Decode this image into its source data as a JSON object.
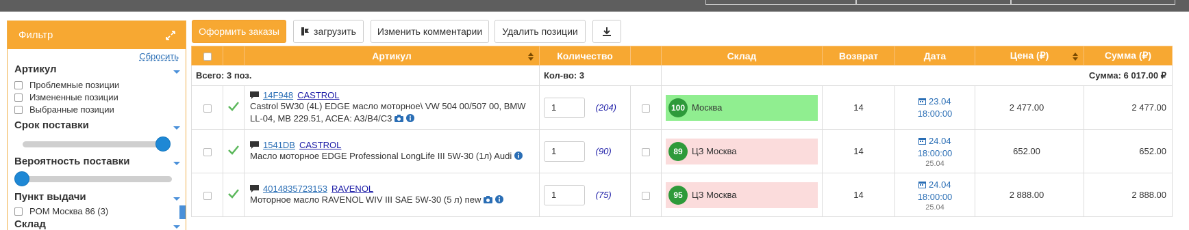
{
  "filter": {
    "title": "Фильтр",
    "reset": "Сбросить",
    "sections": {
      "article": "Артикул",
      "delivery_time": "Срок поставки",
      "delivery_probability": "Вероятность поставки",
      "pickup_point": "Пункт выдачи",
      "warehouse": "Склад"
    },
    "article_options": [
      "Проблемные позиции",
      "Измененные позиции",
      "Выбранные позиции"
    ],
    "pickup_options": [
      "POM Москва 86 (3)"
    ],
    "delivery_time_level": 1.0,
    "delivery_probability_level": 0.0
  },
  "toolbar": {
    "place_orders": "Оформить заказы",
    "upload": "загрузить",
    "change_comments": "Изменить комментарии",
    "delete_positions": "Удалить позиции"
  },
  "table": {
    "headers": {
      "article": "Артикул",
      "quantity": "Количество",
      "warehouse": "Склад",
      "return": "Возврат",
      "date": "Дата",
      "price": "Цена (₽)",
      "sum": "Сумма (₽)"
    },
    "totals": {
      "total_positions": "Всего: 3 поз.",
      "total_qty": "Кол-во: 3",
      "total_sum": "Сумма: 6 017.00 ₽"
    },
    "rows": [
      {
        "code": "14F948",
        "brand": "CASTROL",
        "description": "Castrol 5W30 (4L) EDGE масло моторное\\ VW 504 00/507 00, BMW LL-04, MB 229.51, ACEA: A3/B4/C3",
        "qty": "1",
        "available": "(204)",
        "badge": "100",
        "warehouse": "Москва",
        "warehouse_state": "green",
        "return": "14",
        "date": "23.04",
        "time": "18:00:00",
        "date_extra": "",
        "price": "2 477.00",
        "sum": "2 477.00"
      },
      {
        "code": "1541DB",
        "brand": "CASTROL",
        "description": "Масло моторное EDGE Professional LongLife III 5W-30 (1л) Audi",
        "qty": "1",
        "available": "(90)",
        "badge": "89",
        "warehouse": "ЦЗ Москва",
        "warehouse_state": "pink",
        "return": "14",
        "date": "24.04",
        "time": "18:00:00",
        "date_extra": "25.04",
        "price": "652.00",
        "sum": "652.00"
      },
      {
        "code": "4014835723153",
        "brand": "RAVENOL",
        "description": "Моторное масло RAVENOL WIV III SAE 5W-30 (5 л) new",
        "qty": "1",
        "available": "(75)",
        "badge": "95",
        "warehouse": "ЦЗ Москва",
        "warehouse_state": "pink",
        "return": "14",
        "date": "24.04",
        "time": "18:00:00",
        "date_extra": "25.04",
        "price": "2 888.00",
        "sum": "2 888.00"
      }
    ]
  },
  "colors": {
    "accent": "#f7a832",
    "link": "#2a6eb5",
    "warehouse_green": "#90ee90",
    "warehouse_pink": "#fbdcdc",
    "badge": "#2e9a3a"
  }
}
